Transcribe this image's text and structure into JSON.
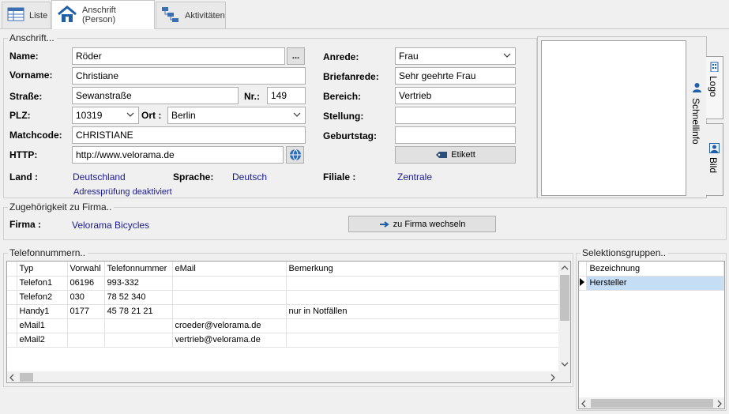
{
  "tabs": [
    {
      "label": "Liste",
      "icon": "table-icon"
    },
    {
      "label": "Anschrift (Person)",
      "icon": "home-icon"
    },
    {
      "label": "Aktivitäten",
      "icon": "activities-icon"
    }
  ],
  "address": {
    "group_title": "Anschrift...",
    "name_label": "Name:",
    "name_value": "Röder",
    "name_button": "...",
    "vorname_label": "Vorname:",
    "vorname_value": "Christiane",
    "strasse_label": "Straße:",
    "strasse_value": "Sewanstraße",
    "nr_label": "Nr.:",
    "nr_value": "149",
    "plz_label": "PLZ:",
    "plz_value": "10319",
    "ort_label": "Ort :",
    "ort_value": "Berlin",
    "matchcode_label": "Matchcode:",
    "matchcode_value": "CHRISTIANE",
    "http_label": "HTTP:",
    "http_value": "http://www.velorama.de",
    "anrede_label": "Anrede:",
    "anrede_value": "Frau",
    "briefanrede_label": "Briefanrede:",
    "briefanrede_value": "Sehr geehrte Frau",
    "bereich_label": "Bereich:",
    "bereich_value": "Vertrieb",
    "stellung_label": "Stellung:",
    "stellung_value": "",
    "geburtstag_label": "Geburtstag:",
    "geburtstag_value": "",
    "etikett_button": "Etikett",
    "land_label": "Land :",
    "land_value": "Deutschland",
    "sprache_label": "Sprache:",
    "sprache_value": "Deutsch",
    "filiale_label": "Filiale :",
    "filiale_value": "Zentrale",
    "adresspruefung": "Adressprüfung deaktiviert"
  },
  "side_panel": {
    "tab_logo": "Logo",
    "tab_schnellinfo": "Schnellinfo",
    "tab_bild": "Bild"
  },
  "company": {
    "group_title": "Zugehörigkeit zu Firma..",
    "firma_label": "Firma :",
    "firma_value": "Velorama Bicycles",
    "switch_button": "zu Firma wechseln"
  },
  "phones": {
    "group_title": "Telefonnummern..",
    "columns": [
      "Typ",
      "Vorwahl",
      "Telefonnummer",
      "eMail",
      "Bemerkung"
    ],
    "rows": [
      [
        "Telefon1",
        "06196",
        "993-332",
        "",
        ""
      ],
      [
        "Telefon2",
        "030",
        "78 52 340",
        "",
        ""
      ],
      [
        "Handy1",
        "0177",
        "45 78 21 21",
        "",
        "nur in Notfällen"
      ],
      [
        "eMail1",
        "",
        "",
        "croeder@velorama.de",
        ""
      ],
      [
        "eMail2",
        "",
        "",
        "vertrieb@velorama.de",
        ""
      ]
    ]
  },
  "selection": {
    "group_title": "Selektionsgruppen..",
    "column": "Bezeichnung",
    "rows": [
      "Hersteller"
    ]
  },
  "colors": {
    "link": "#1a1a8c",
    "selected_row": "#c5def5",
    "icon_blue": "#1f5fa8"
  }
}
